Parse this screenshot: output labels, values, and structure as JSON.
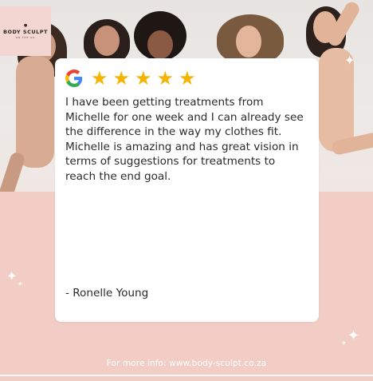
{
  "brand": {
    "name": "BODY SCULPT",
    "tagline": "ON THE GO"
  },
  "review": {
    "rating": 5,
    "stars": [
      "★",
      "★",
      "★",
      "★",
      "★"
    ],
    "text": "I have been getting treatments from Michelle for one week and I can already see the difference in the way my clothes fit. Michelle is amazing and has great vision in terms of suggestions for treatments to reach the end goal.",
    "author": "- Ronelle Young",
    "source_icon": "google-g-icon"
  },
  "footer": {
    "text": "For more info: www.body-sculpt.co.za"
  },
  "colors": {
    "background": "#f1cdc5",
    "card": "#ffffff",
    "star": "#f4b400",
    "google_blue": "#4285F4",
    "google_red": "#EA4335",
    "google_yellow": "#FBBC05",
    "google_green": "#34A853"
  }
}
